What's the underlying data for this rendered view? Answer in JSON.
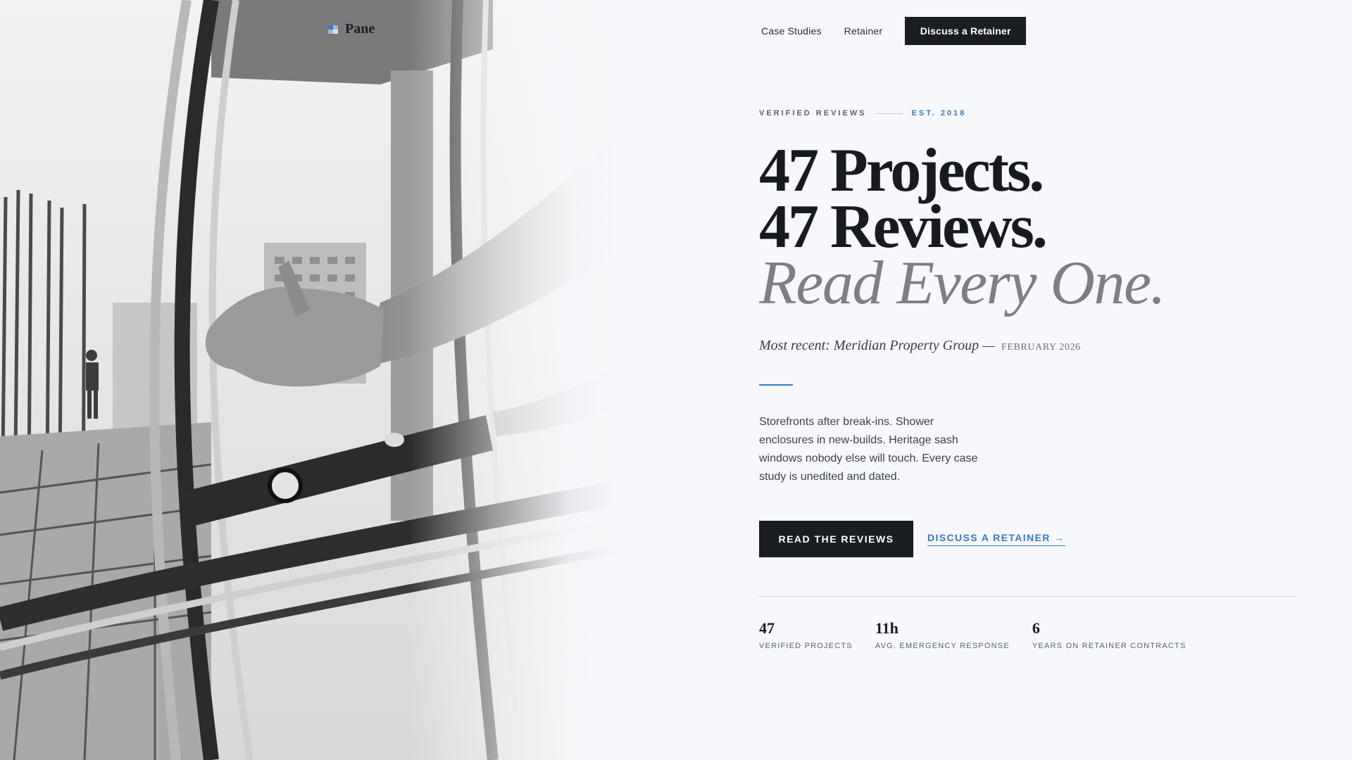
{
  "logo": {
    "text": "Pane",
    "icon": "flag-icon"
  },
  "nav": {
    "links": [
      "Case Studies",
      "Retainer"
    ],
    "cta": "Discuss a Retainer"
  },
  "hero": {
    "eyebrow_left": "VERIFIED REVIEWS",
    "eyebrow_right": "EST. 2018",
    "headline_line1": "47 Projects.",
    "headline_line2": "47 Reviews.",
    "headline_line3": "Read Every One.",
    "recent_text": "Most recent: Meridian Property Group —",
    "recent_date": "FEBRUARY 2026",
    "description": "Storefronts after break-ins. Shower enclosures in new-builds. Heritage sash windows nobody else will touch. Every case study is unedited and dated.",
    "primary_cta": "READ THE REVIEWS",
    "secondary_cta": "DISCUSS A RETAINER →"
  },
  "stats": [
    {
      "value": "47",
      "label": "VERIFIED PROJECTS"
    },
    {
      "value": "11h",
      "label": "AVG. EMERGENCY RESPONSE"
    },
    {
      "value": "6",
      "label": "YEARS ON RETAINER CONTRACTS"
    }
  ],
  "colors": {
    "background": "#f6f8fb",
    "dark": "#1a1d22",
    "accent": "#3b78c4",
    "muted": "#7d7f83"
  }
}
